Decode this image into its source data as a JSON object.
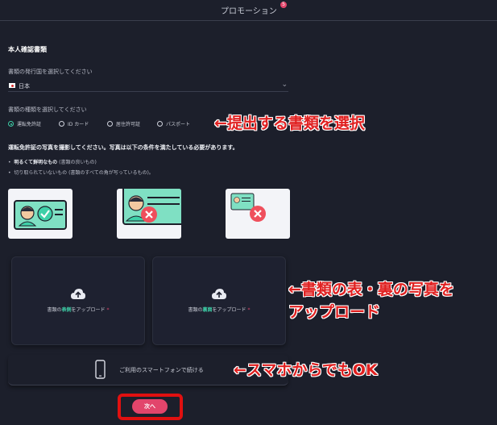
{
  "header": {
    "title": "プロモーション",
    "badge": "5"
  },
  "section_title": "本人確認書類",
  "country": {
    "label": "書類の発行国を選択してください",
    "value": "日本"
  },
  "doc_type": {
    "label": "書類の種類を選択してください",
    "options": [
      "運転免許証",
      "ID カード",
      "居住許可証",
      "パスポート"
    ],
    "selected": "運転免許証"
  },
  "instructions": {
    "title": "運転免許証の写真を撮影してください。写真は以下の条件を満たしている必要があります。",
    "bullets": [
      {
        "bold": "明るくて鮮明なもの",
        "note": "(書類の良いもの)"
      },
      {
        "bold": "",
        "note": "切り取られていないもの (書類のすべての角が写っているもの)。"
      }
    ]
  },
  "upload": {
    "front": {
      "pre": "書類の",
      "hl": "表側",
      "post": "をアップロード",
      "req": "*"
    },
    "back": {
      "pre": "書類の",
      "hl": "裏面",
      "post": "をアップロード",
      "req": "*"
    }
  },
  "phone_continue": "ご利用のスマートフォンで続ける",
  "next_button": "次へ",
  "annotations": {
    "select_doc": "←提出する書類を選択",
    "upload_line1": "←書類の表・裏の写真を",
    "upload_line2": "アップロード",
    "smartphone": "←スマホからでもOK"
  },
  "colors": {
    "background": "#1c1f2b",
    "accent": "#3ed0a8",
    "primary_button": "#e2456b",
    "annotation": "#e02020"
  },
  "icons": {
    "upload": "cloud-upload-icon",
    "phone": "smartphone-icon",
    "dropdown": "chevron-down-icon",
    "good_example": "check-icon",
    "bad_example": "close-icon"
  }
}
